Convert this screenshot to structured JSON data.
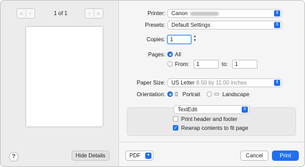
{
  "preview": {
    "nav_first": "«",
    "nav_prev": "‹",
    "nav_next": "›",
    "nav_last": "»",
    "page_indicator": "1 of 1"
  },
  "left_footer": {
    "help": "?",
    "hide_details": "Hide Details"
  },
  "printer": {
    "label": "Printer:",
    "value": "Canon"
  },
  "presets": {
    "label": "Presets:",
    "value": "Default Settings"
  },
  "copies": {
    "label": "Copies:",
    "value": "1"
  },
  "pages": {
    "label": "Pages:",
    "all_label": "All",
    "from_label": "From:",
    "from_value": "1",
    "to_label": "to:",
    "to_value": "1",
    "selected": "All"
  },
  "paper_size": {
    "label": "Paper Size:",
    "value": "US Letter",
    "dimensions": "8.50 by 11.00 inches"
  },
  "orientation": {
    "label": "Orientation:",
    "portrait": "Portrait",
    "landscape": "Landscape",
    "selected": "Portrait"
  },
  "app_section": {
    "popup_value": "TextEdit",
    "print_header_footer": "Print header and footer",
    "print_header_footer_checked": false,
    "rewrap": "Rewrap contents to fit page",
    "rewrap_checked": true
  },
  "footer": {
    "pdf": "PDF",
    "cancel": "Cancel",
    "print": "Print"
  },
  "colors": {
    "accent": "#1f6ff0",
    "window": "#ececec",
    "panel": "#f5f5f5"
  }
}
